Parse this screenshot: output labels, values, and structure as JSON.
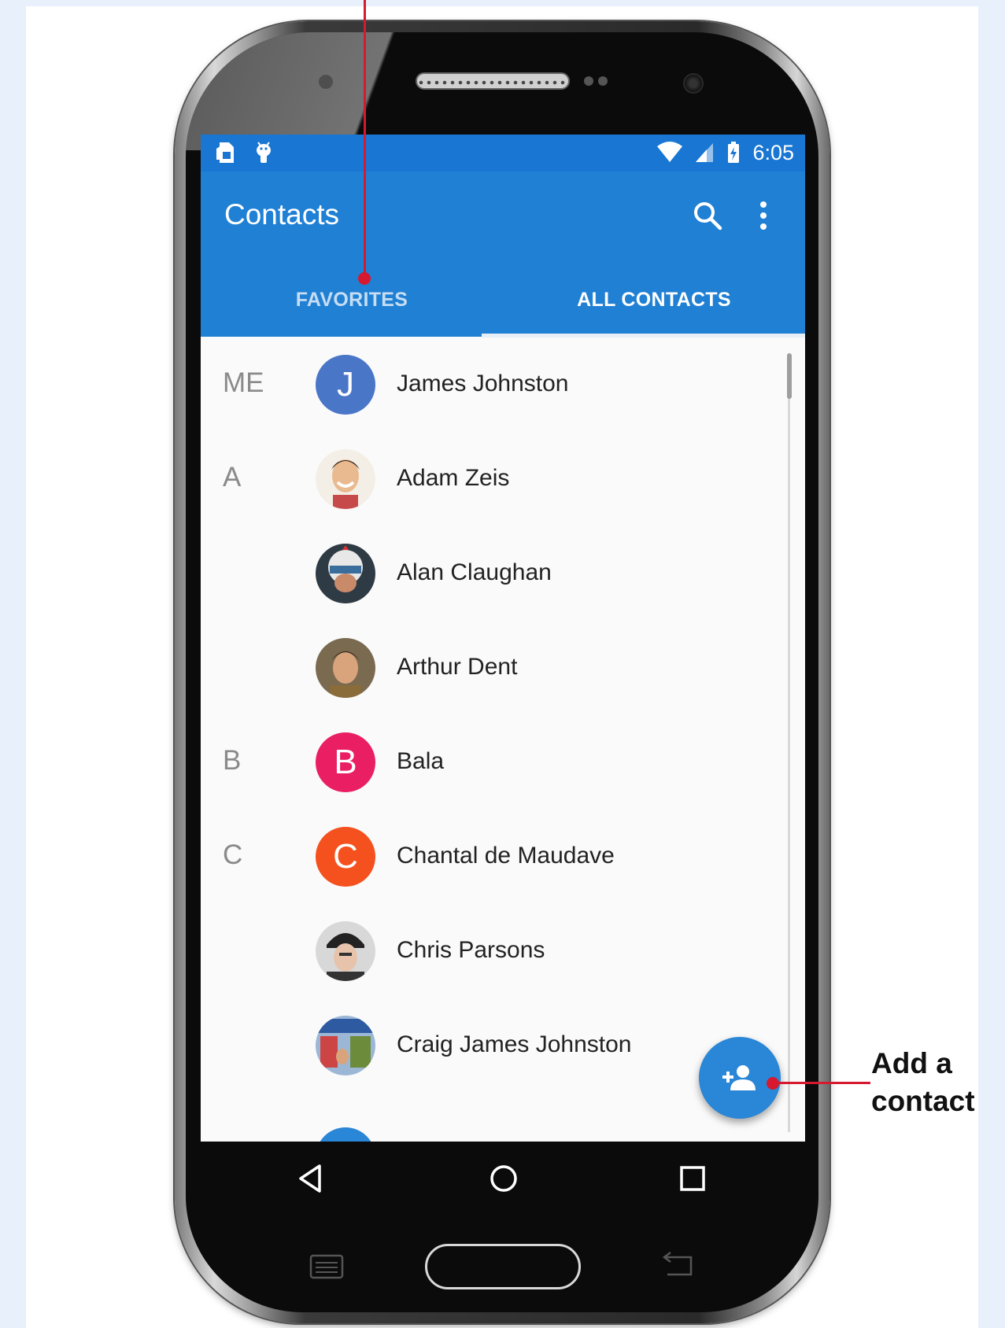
{
  "status_bar": {
    "time": "6:05"
  },
  "app_bar": {
    "title": "Contacts"
  },
  "tabs": [
    {
      "label": "FAVORITES",
      "selected": false
    },
    {
      "label": "ALL CONTACTS",
      "selected": true
    }
  ],
  "contacts": [
    {
      "section": "ME",
      "name": "James Johnston",
      "avatar_letter": "J",
      "avatar_color": "#4a76c8"
    },
    {
      "section": "A",
      "name": "Adam Zeis",
      "avatar_letter": "",
      "avatar_color": "#d9c6a8"
    },
    {
      "section": "",
      "name": "Alan Claughan",
      "avatar_letter": "",
      "avatar_color": "#3d4a55"
    },
    {
      "section": "",
      "name": "Arthur Dent",
      "avatar_letter": "",
      "avatar_color": "#6b5742"
    },
    {
      "section": "B",
      "name": "Bala",
      "avatar_letter": "B",
      "avatar_color": "#e91e63"
    },
    {
      "section": "C",
      "name": "Chantal de Maudave",
      "avatar_letter": "C",
      "avatar_color": "#f4511e"
    },
    {
      "section": "",
      "name": "Chris Parsons",
      "avatar_letter": "",
      "avatar_color": "#4a4a4a"
    },
    {
      "section": "",
      "name": "Craig James Johnston",
      "avatar_letter": "",
      "avatar_color": "#5a7aa8"
    }
  ],
  "callouts": {
    "add_contact": {
      "line1": "Add a",
      "line2": "contact"
    }
  },
  "colors": {
    "status_bar": "#1976d2",
    "app_bar": "#2080d4",
    "fab": "#2a86d6",
    "callout": "#d6192f"
  },
  "icons": {
    "status_left": [
      "sim-card-icon",
      "android-debug-icon"
    ],
    "status_right": [
      "wifi-icon",
      "cell-signal-icon",
      "battery-charging-icon"
    ],
    "app_bar": [
      "search-icon",
      "more-vert-icon"
    ],
    "fab": "person-add-icon",
    "nav": [
      "back-icon",
      "home-icon",
      "recents-icon"
    ]
  }
}
